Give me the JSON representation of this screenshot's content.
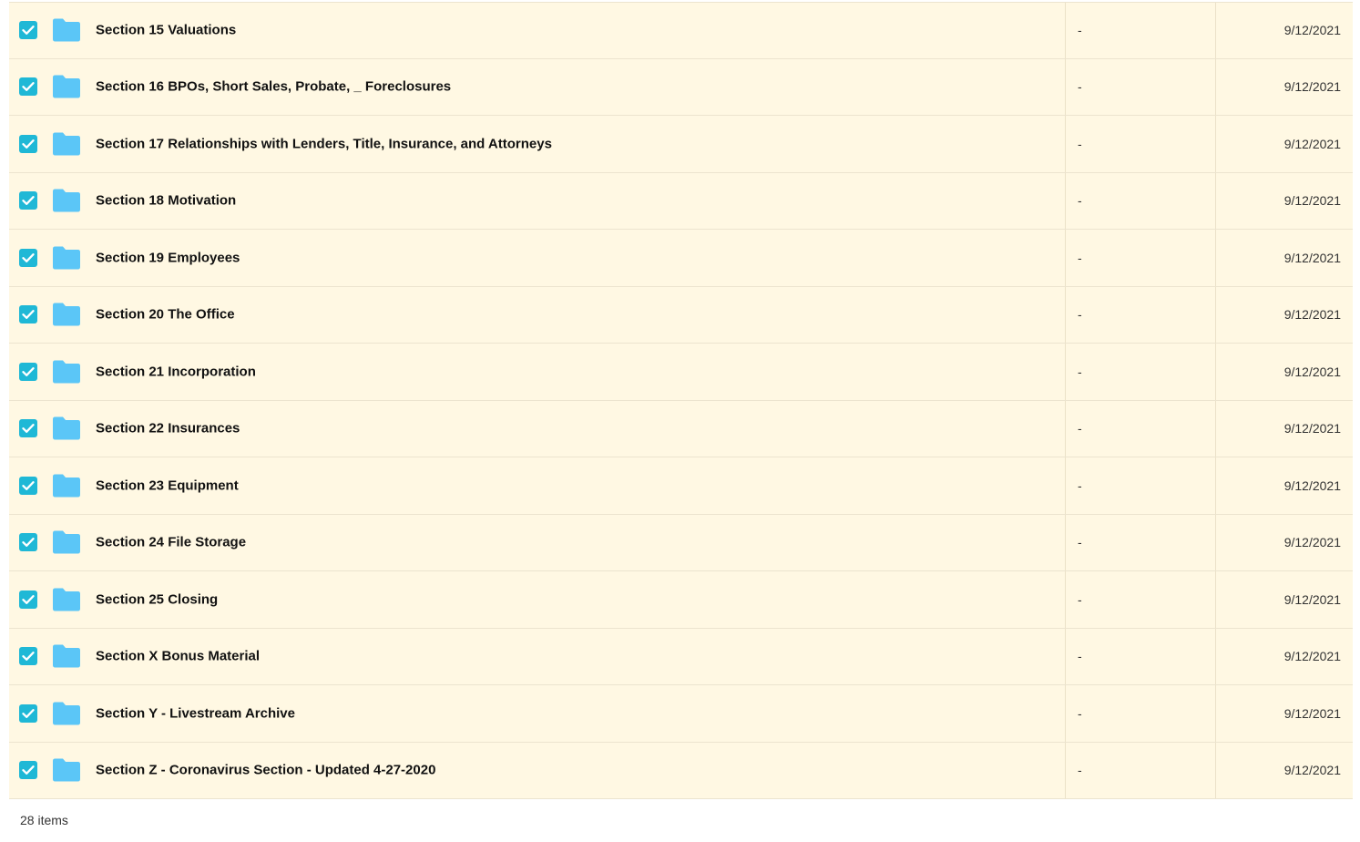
{
  "colors": {
    "row_background": "#fff8e3",
    "checkbox": "#1fb8d6",
    "folder": "#5bc6f7"
  },
  "file_list": {
    "rows": [
      {
        "name": "Section 15 Valuations",
        "size": "-",
        "date": "9/12/2021",
        "checked": true,
        "icon": "folder-icon"
      },
      {
        "name": "Section 16 BPOs, Short Sales, Probate, _ Foreclosures",
        "size": "-",
        "date": "9/12/2021",
        "checked": true,
        "icon": "folder-icon"
      },
      {
        "name": "Section 17 Relationships with Lenders, Title, Insurance, and Attorneys",
        "size": "-",
        "date": "9/12/2021",
        "checked": true,
        "icon": "folder-icon"
      },
      {
        "name": "Section 18 Motivation",
        "size": "-",
        "date": "9/12/2021",
        "checked": true,
        "icon": "folder-icon"
      },
      {
        "name": "Section 19 Employees",
        "size": "-",
        "date": "9/12/2021",
        "checked": true,
        "icon": "folder-icon"
      },
      {
        "name": "Section 20 The Office",
        "size": "-",
        "date": "9/12/2021",
        "checked": true,
        "icon": "folder-icon"
      },
      {
        "name": "Section 21 Incorporation",
        "size": "-",
        "date": "9/12/2021",
        "checked": true,
        "icon": "folder-icon"
      },
      {
        "name": "Section 22 Insurances",
        "size": "-",
        "date": "9/12/2021",
        "checked": true,
        "icon": "folder-icon"
      },
      {
        "name": "Section 23 Equipment",
        "size": "-",
        "date": "9/12/2021",
        "checked": true,
        "icon": "folder-icon"
      },
      {
        "name": "Section 24 File Storage",
        "size": "-",
        "date": "9/12/2021",
        "checked": true,
        "icon": "folder-icon"
      },
      {
        "name": "Section 25 Closing",
        "size": "-",
        "date": "9/12/2021",
        "checked": true,
        "icon": "folder-icon"
      },
      {
        "name": "Section X Bonus Material",
        "size": "-",
        "date": "9/12/2021",
        "checked": true,
        "icon": "folder-icon"
      },
      {
        "name": "Section Y - Livestream Archive",
        "size": "-",
        "date": "9/12/2021",
        "checked": true,
        "icon": "folder-icon"
      },
      {
        "name": "Section Z - Coronavirus Section - Updated 4-27-2020",
        "size": "-",
        "date": "9/12/2021",
        "checked": true,
        "icon": "folder-icon"
      }
    ]
  },
  "footer": {
    "item_count": "28 items"
  }
}
